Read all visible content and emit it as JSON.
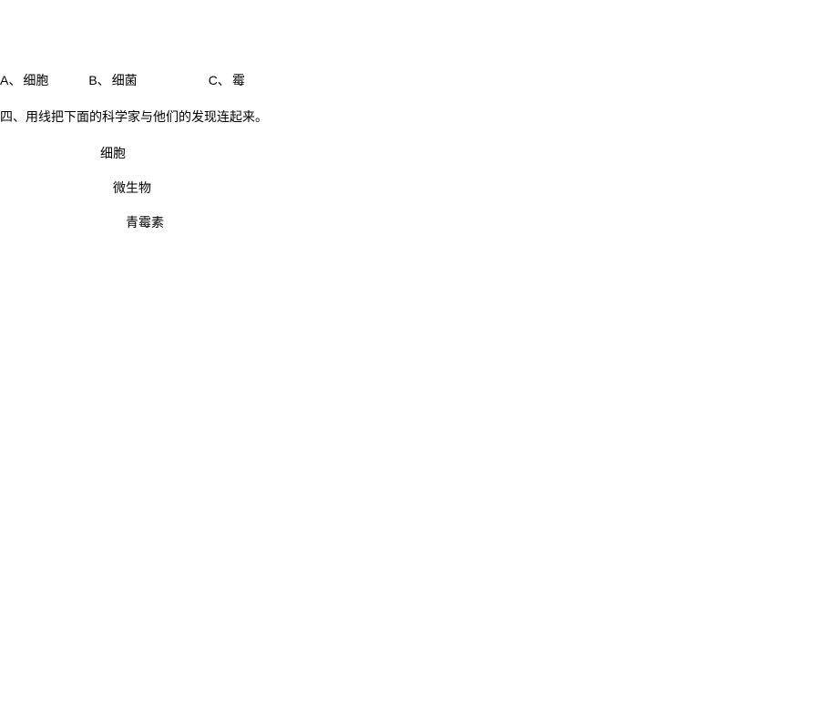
{
  "options": {
    "a": {
      "label": "A、",
      "text": "细胞"
    },
    "b": {
      "label": "B、",
      "text": "细菌"
    },
    "c": {
      "label": "C、",
      "text": "霉"
    }
  },
  "question": {
    "number": "四、",
    "text": "用线把下面的科学家与他们的发现连起来。"
  },
  "matching": {
    "item1": "细胞",
    "item2": "微生物",
    "item3": "青霉素"
  }
}
